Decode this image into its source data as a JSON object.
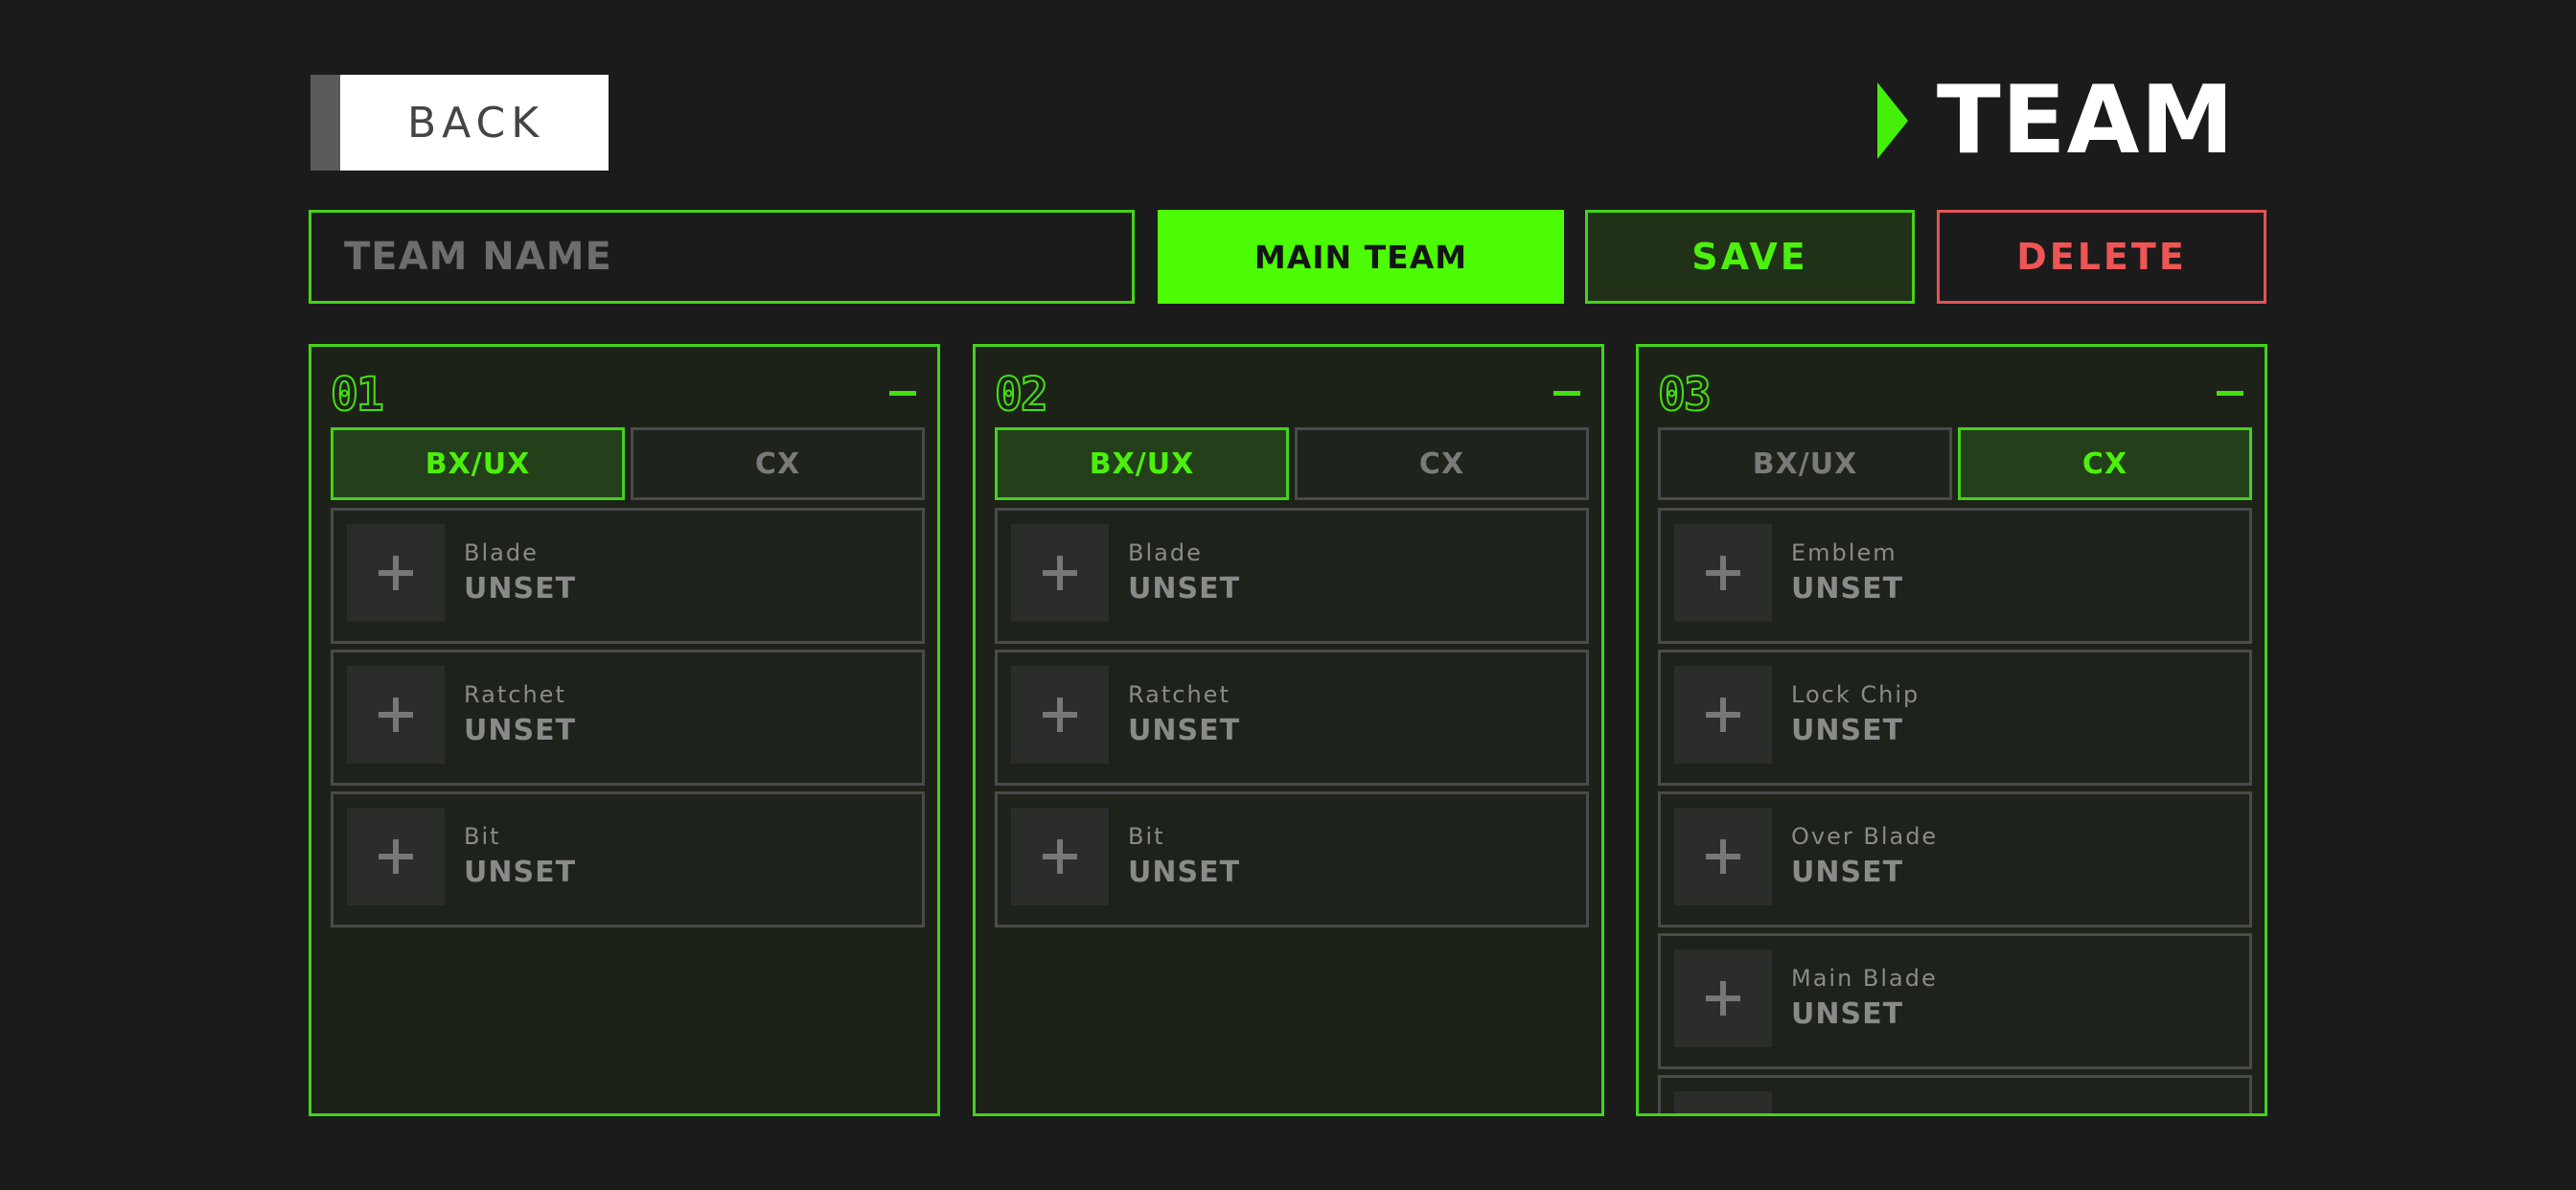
{
  "header": {
    "back_label": "BACK",
    "title": "TEAM"
  },
  "toolbar": {
    "team_name_placeholder": "TEAM NAME",
    "main_team_label": "MAIN TEAM",
    "save_label": "SAVE",
    "delete_label": "DELETE"
  },
  "colors": {
    "accent": "#4cfc04",
    "danger": "#ee5555",
    "background": "#1b1b1b"
  },
  "slots": [
    {
      "number": "01",
      "tabs": [
        "BX/UX",
        "CX"
      ],
      "active_tab": 0,
      "parts": [
        {
          "type": "Blade",
          "value": "UNSET"
        },
        {
          "type": "Ratchet",
          "value": "UNSET"
        },
        {
          "type": "Bit",
          "value": "UNSET"
        }
      ]
    },
    {
      "number": "02",
      "tabs": [
        "BX/UX",
        "CX"
      ],
      "active_tab": 0,
      "parts": [
        {
          "type": "Blade",
          "value": "UNSET"
        },
        {
          "type": "Ratchet",
          "value": "UNSET"
        },
        {
          "type": "Bit",
          "value": "UNSET"
        }
      ]
    },
    {
      "number": "03",
      "tabs": [
        "BX/UX",
        "CX"
      ],
      "active_tab": 1,
      "parts": [
        {
          "type": "Emblem",
          "value": "UNSET"
        },
        {
          "type": "Lock Chip",
          "value": "UNSET"
        },
        {
          "type": "Over Blade",
          "value": "UNSET"
        },
        {
          "type": "Main Blade",
          "value": "UNSET"
        }
      ]
    }
  ]
}
